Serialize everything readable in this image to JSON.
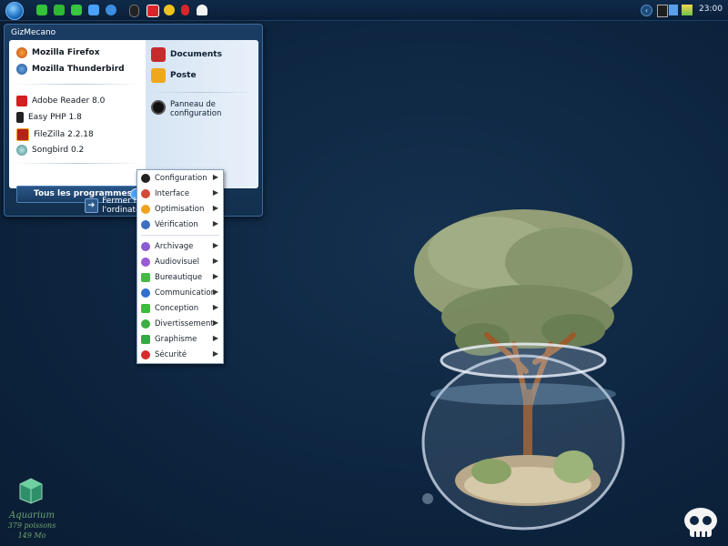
{
  "taskbar": {
    "clock": "23:00",
    "quicklaunch": [
      {
        "icon": "green-app-icon",
        "color": "#33c23a"
      },
      {
        "icon": "green-app-icon",
        "color": "#2fb836"
      },
      {
        "icon": "green-app-icon",
        "color": "#38c540"
      },
      {
        "icon": "monitor-icon",
        "color": "#4aa0ff"
      },
      {
        "icon": "globe-icon",
        "color": "#3b8de0"
      },
      {
        "icon": "mouse-icon",
        "color": "#222222"
      },
      {
        "icon": "red-app-icon",
        "color": "#d9262b"
      },
      {
        "icon": "yellow-app-icon",
        "color": "#f0c21e"
      },
      {
        "icon": "red-mouse-icon",
        "color": "#d9262b"
      },
      {
        "icon": "ghost-icon",
        "color": "#f2f2f2"
      }
    ]
  },
  "start_menu": {
    "user_name": "GizMecano",
    "pinned": [
      "Mozilla Firefox",
      "Mozilla Thunderbird"
    ],
    "recent": [
      "Adobe Reader 8.0",
      "Easy PHP 1.8",
      "FileZilla 2.2.18",
      "Songbird 0.2"
    ],
    "all_programs": "Tous les programmes",
    "right": {
      "documents": "Documents",
      "poste": "Poste",
      "panneau": "Panneau de configuration"
    },
    "shutdown": "Fermer la session ou éteindre l'ordinateur"
  },
  "submenu": {
    "group1": [
      "Configuration",
      "Interface",
      "Optimisation",
      "Vérification"
    ],
    "group2": [
      "Archivage",
      "Audiovisuel",
      "Bureautique",
      "Communication",
      "Conception",
      "Divertissement",
      "Graphisme",
      "Sécurité"
    ]
  },
  "desktop_icon": {
    "name": "Aquarium",
    "line2": "379 poissons",
    "line3": "149 Mo"
  },
  "colors": {
    "accent": "#2a5788",
    "desktop": "#0d2540"
  }
}
